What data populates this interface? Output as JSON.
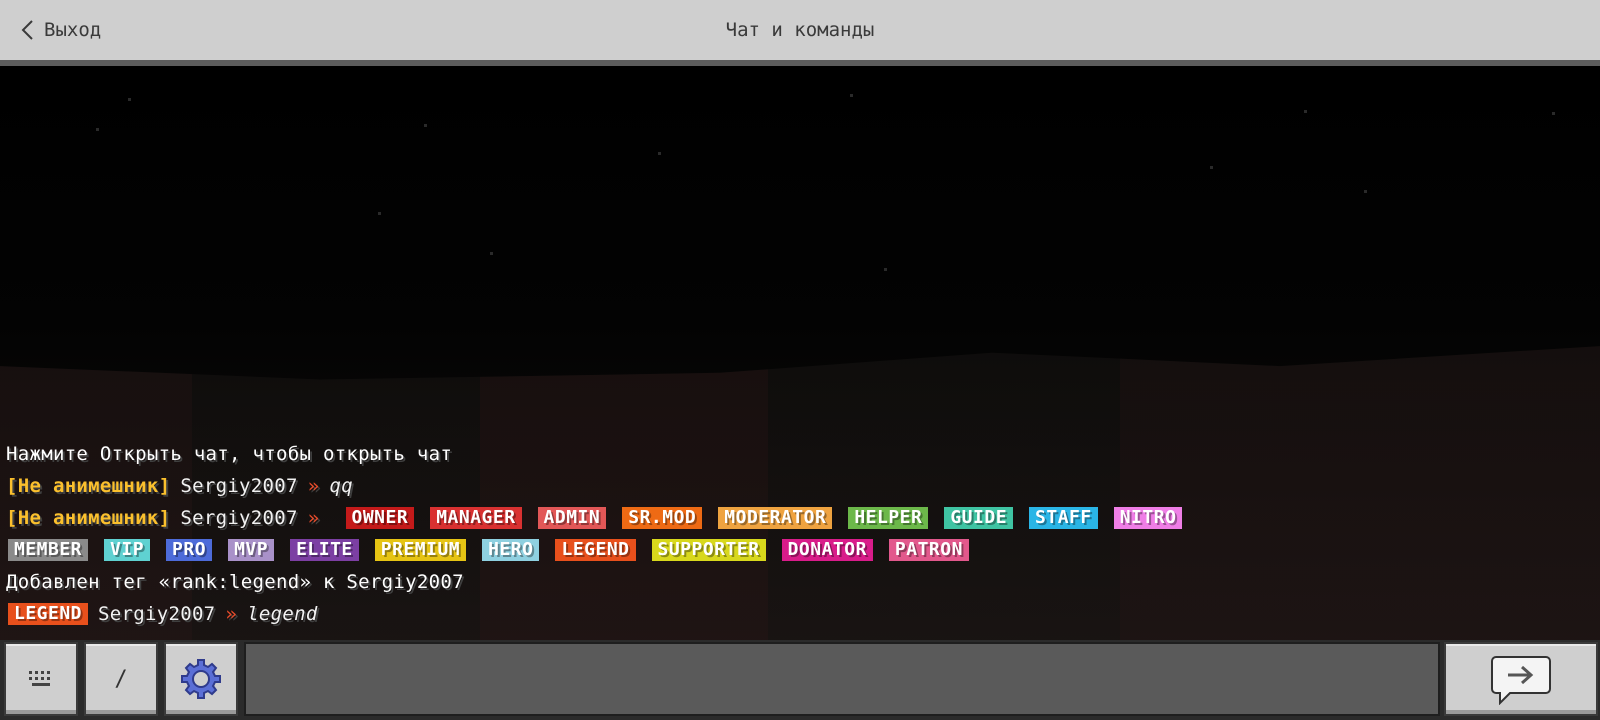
{
  "header": {
    "back_label": "Выход",
    "title": "Чат и команды"
  },
  "chat": {
    "line1": "Нажмите Открыть чат, чтобы открыть чат",
    "line2": {
      "prefix": "[Не анимешник]",
      "user": "Sergiy2007",
      "arrow": "»",
      "message": "qq"
    },
    "line3": {
      "prefix": "[Не анимешник]",
      "user": "Sergiy2007",
      "arrow": "»"
    },
    "tags_row1": [
      {
        "label": "OWNER",
        "color": "#c41a1a"
      },
      {
        "label": "MANAGER",
        "color": "#d93131"
      },
      {
        "label": "ADMIN",
        "color": "#e25757"
      },
      {
        "label": "SR.MOD",
        "color": "#ee6a14"
      },
      {
        "label": "MODERATOR",
        "color": "#efa340"
      },
      {
        "label": "HELPER",
        "color": "#6cb84a"
      },
      {
        "label": "GUIDE",
        "color": "#3fc4a3"
      },
      {
        "label": "STAFF",
        "color": "#2ab5e6"
      },
      {
        "label": "NITRO",
        "color": "#ef7ee6"
      }
    ],
    "tags_row2": [
      {
        "label": "MEMBER",
        "color": "#8a8a8a"
      },
      {
        "label": "VIP",
        "color": "#5fd1d1"
      },
      {
        "label": "PRO",
        "color": "#4d6bd9"
      },
      {
        "label": "MVP",
        "color": "#a991c9"
      },
      {
        "label": "ELITE",
        "color": "#7c3fa3"
      },
      {
        "label": "PREMIUM",
        "color": "#e6c414"
      },
      {
        "label": "HERO",
        "color": "#8fd0e0"
      },
      {
        "label": "LEGEND",
        "color": "#e8501c"
      },
      {
        "label": "SUPPORTER",
        "color": "#d8d81c"
      },
      {
        "label": "DONATOR",
        "color": "#d91c8a"
      },
      {
        "label": "PATRON",
        "color": "#e2588c"
      }
    ],
    "line5": "Добавлен тег «rank:legend» к Sergiy2007",
    "line6": {
      "tag": "LEGEND",
      "tag_color": "#e8501c",
      "user": "Sergiy2007",
      "arrow": "»",
      "message": "legend"
    }
  },
  "toolbar": {
    "keyboard_icon": "keyboard-icon",
    "slash_label": "/",
    "settings_icon": "gear-icon",
    "input_value": "",
    "send_icon": "send-arrow-icon"
  },
  "colors": {
    "header_bg": "#cfcfcf",
    "prefix_yellow": "#fbc02d",
    "arrow_red": "#e84b2a"
  }
}
